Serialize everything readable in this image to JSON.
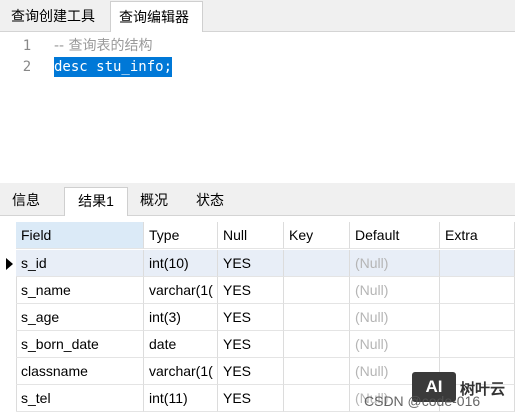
{
  "top_tabs": [
    "查询创建工具",
    "查询编辑器"
  ],
  "editor": {
    "lines": [
      {
        "num": "1",
        "text": "-- 查询表的结构"
      },
      {
        "num": "2",
        "text": "desc stu_info;"
      }
    ]
  },
  "bottom_tabs": [
    "信息",
    "结果1",
    "概况",
    "状态"
  ],
  "grid": {
    "columns": [
      "Field",
      "Type",
      "Null",
      "Key",
      "Default",
      "Extra"
    ],
    "rows": [
      [
        "s_id",
        "int(10)",
        "YES",
        "",
        "(Null)",
        ""
      ],
      [
        "s_name",
        "varchar(1(",
        "YES",
        "",
        "(Null)",
        ""
      ],
      [
        "s_age",
        "int(3)",
        "YES",
        "",
        "(Null)",
        ""
      ],
      [
        "s_born_date",
        "date",
        "YES",
        "",
        "(Null)",
        ""
      ],
      [
        "classname",
        "varchar(1(",
        "YES",
        "",
        "(Null)",
        ""
      ],
      [
        "s_tel",
        "int(11)",
        "YES",
        "",
        "(Null)",
        ""
      ]
    ]
  },
  "watermark": {
    "logo": "AI",
    "brand": "树叶云",
    "text": "CSDN @code-016"
  }
}
